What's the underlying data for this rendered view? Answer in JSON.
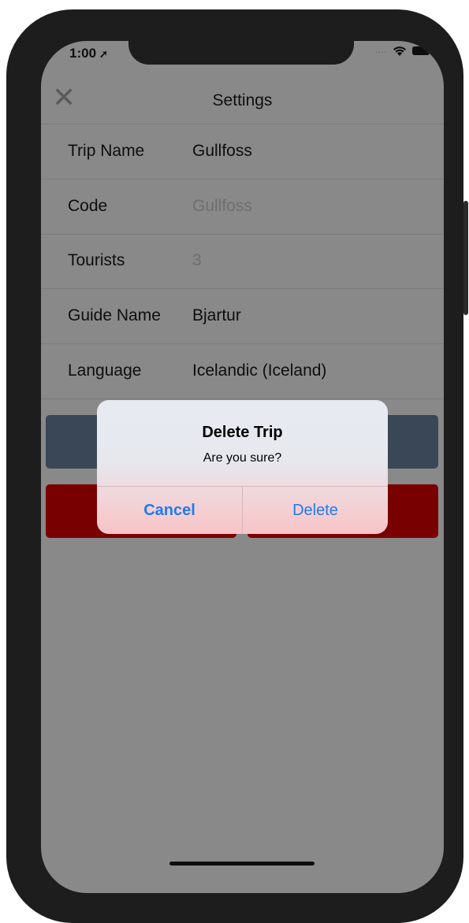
{
  "status_bar": {
    "time": "1:00",
    "location_icon": "location-arrow-icon",
    "signal": "....",
    "wifi_icon": "wifi-icon",
    "battery_icon": "battery-icon"
  },
  "navbar": {
    "title": "Settings",
    "close_icon": "close-icon"
  },
  "rows": [
    {
      "label": "Trip Name",
      "value": "Gullfoss"
    },
    {
      "label": "Code",
      "value": "Gullfoss"
    },
    {
      "label": "Tourists",
      "value": "3"
    },
    {
      "label": "Guide Name",
      "value": "Bjartur"
    },
    {
      "label": "Language",
      "value": "Icelandic (Iceland)"
    }
  ],
  "alert": {
    "title": "Delete Trip",
    "message": "Are you sure?",
    "cancel_label": "Cancel",
    "delete_label": "Delete"
  },
  "colors": {
    "overlay_bg": "#898989",
    "slate_button": "#3a4757",
    "danger_button": "#790000",
    "alert_action": "#1f7bf2"
  }
}
